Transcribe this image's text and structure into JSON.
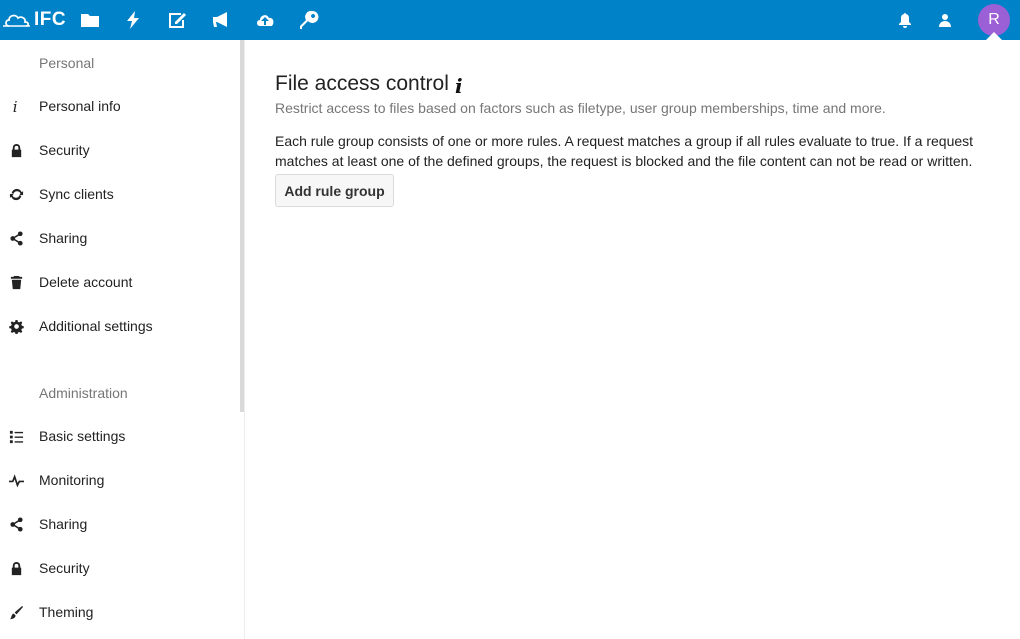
{
  "header": {
    "logo_text": "IFC",
    "apps": [
      {
        "icon": "folder-icon",
        "name": "Files"
      },
      {
        "icon": "activity-icon",
        "name": "Activity"
      },
      {
        "icon": "notes-icon",
        "name": "Notes"
      },
      {
        "icon": "announcement-icon",
        "name": "Announcements"
      },
      {
        "icon": "cloud-upload-icon",
        "name": "Upload"
      },
      {
        "icon": "key-icon",
        "name": "Passwords"
      }
    ],
    "right_icons": [
      "notifications-icon",
      "contacts-icon"
    ],
    "avatar_initial": "R",
    "colors": {
      "header_bg": "#0082c9",
      "avatar_bg": "#9b5fd6"
    }
  },
  "sidebar": {
    "personal_title": "Personal",
    "personal_items": [
      {
        "label": "Personal info",
        "icon": "info-icon"
      },
      {
        "label": "Security",
        "icon": "lock-icon"
      },
      {
        "label": "Sync clients",
        "icon": "sync-icon"
      },
      {
        "label": "Sharing",
        "icon": "share-icon"
      },
      {
        "label": "Delete account",
        "icon": "trash-icon"
      },
      {
        "label": "Additional settings",
        "icon": "gear-icon"
      }
    ],
    "admin_title": "Administration",
    "admin_items": [
      {
        "label": "Basic settings",
        "icon": "list-icon"
      },
      {
        "label": "Monitoring",
        "icon": "pulse-icon"
      },
      {
        "label": "Sharing",
        "icon": "share-icon"
      },
      {
        "label": "Security",
        "icon": "lock-icon"
      },
      {
        "label": "Theming",
        "icon": "brush-icon"
      }
    ]
  },
  "main": {
    "title": "File access control",
    "info_glyph": "i",
    "subtitle": "Restrict access to files based on factors such as filetype, user group memberships, time and more.",
    "description": "Each rule group consists of one or more rules. A request matches a group if all rules evaluate to true. If a request matches at least one of the defined groups, the request is blocked and the file content can not be read or written.",
    "add_button": "Add rule group"
  }
}
